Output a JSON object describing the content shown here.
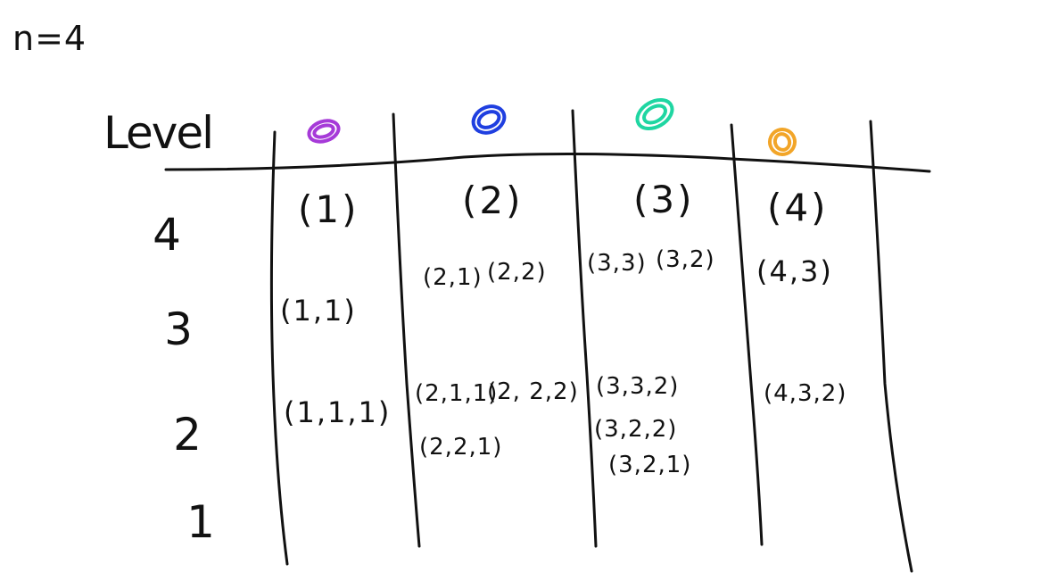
{
  "title": "n=4",
  "level_label": "Level",
  "row_labels": [
    "4",
    "3",
    "2",
    "1"
  ],
  "columns": [
    {
      "header": "(1)",
      "color": "#a63ad8"
    },
    {
      "header": "(2)",
      "color": "#1f3fe0"
    },
    {
      "header": "(3)",
      "color": "#1fd6a2"
    },
    {
      "header": "(4)",
      "color": "#f2a528"
    }
  ],
  "cells": {
    "col1": {
      "level3": [
        "(1,1)"
      ],
      "level2": [
        "(1,1,1)"
      ]
    },
    "col2": {
      "level3": [
        "(2,1)",
        "(2,2)"
      ],
      "level2": [
        "(2,1,1)",
        "(2, 2,2)",
        "(2,2,1)"
      ]
    },
    "col3": {
      "level3": [
        "(3,3)",
        "(3,2)"
      ],
      "level2": [
        "(3,3,2)",
        "(3,2,2)",
        "(3,2,1)"
      ]
    },
    "col4": {
      "level3": [
        "(4,3)"
      ],
      "level2": [
        "(4,3,2)"
      ]
    }
  }
}
